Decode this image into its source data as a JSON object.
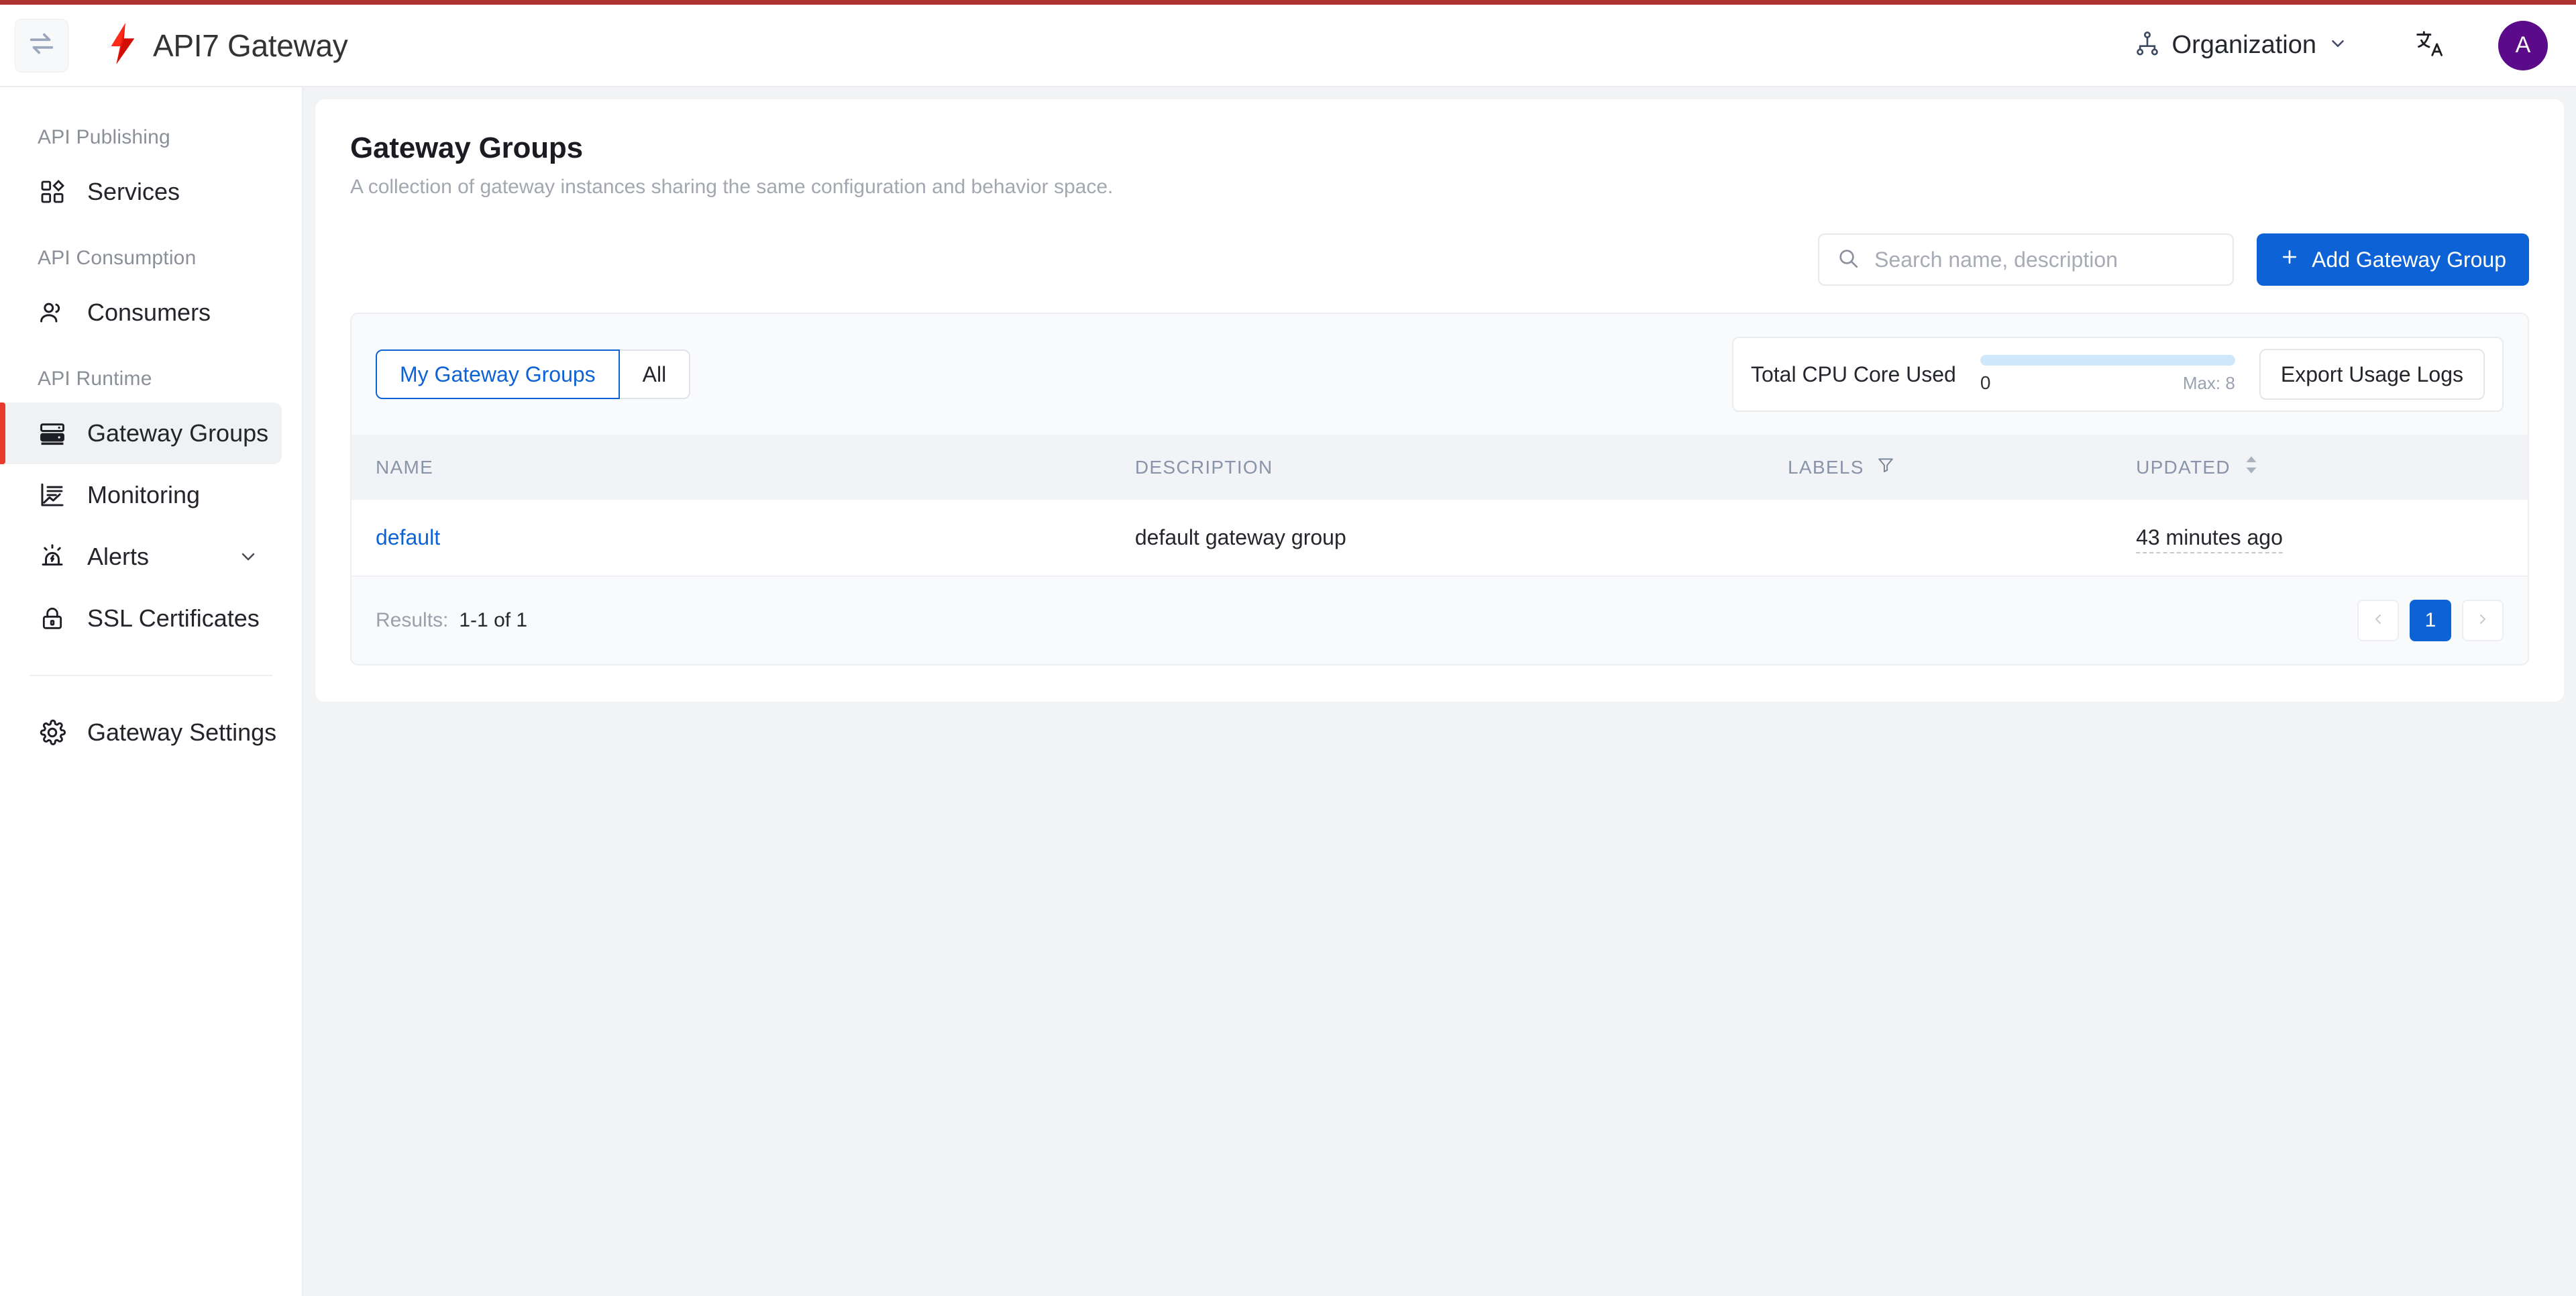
{
  "theme": {
    "accent_blue": "#0d63d6",
    "brand_red": "#e8392c",
    "stripe_red": "#ad3333",
    "avatar_purple": "#5b0b8a",
    "cpu_bar_blue": "#cfe7fb"
  },
  "header": {
    "collapse_icon": "collapse-sidebar-icon",
    "logo_icon": "api7-lightning-logo",
    "title": "API7 Gateway",
    "org_icon": "organization-hierarchy-icon",
    "org_label": "Organization",
    "org_chevron_icon": "chevron-down-icon",
    "language_icon": "translate-icon",
    "avatar_initial": "A"
  },
  "sidebar": {
    "groups": [
      {
        "title": "API Publishing",
        "items": [
          {
            "label": "Services",
            "icon": "grid-shapes-icon",
            "active": false,
            "expandable": false
          }
        ]
      },
      {
        "title": "API Consumption",
        "items": [
          {
            "label": "Consumers",
            "icon": "users-icon",
            "active": false,
            "expandable": false
          }
        ]
      },
      {
        "title": "API Runtime",
        "items": [
          {
            "label": "Gateway Groups",
            "icon": "server-rack-icon",
            "active": true,
            "expandable": false
          },
          {
            "label": "Monitoring",
            "icon": "chart-line-icon",
            "active": false,
            "expandable": false
          },
          {
            "label": "Alerts",
            "icon": "alarm-light-icon",
            "active": false,
            "expandable": true
          },
          {
            "label": "SSL Certificates",
            "icon": "lock-icon",
            "active": false,
            "expandable": false
          }
        ]
      }
    ],
    "footer_items": [
      {
        "label": "Gateway Settings",
        "icon": "gear-icon"
      }
    ]
  },
  "page": {
    "title": "Gateway Groups",
    "subtitle": "A collection of gateway instances sharing the same configuration and behavior space."
  },
  "toolbar": {
    "search_icon": "search-icon",
    "search_placeholder": "Search name, description",
    "search_value": "",
    "add_button_label": "Add Gateway Group",
    "add_button_icon": "plus-icon"
  },
  "tabs": [
    {
      "label": "My Gateway Groups",
      "active": true
    },
    {
      "label": "All",
      "active": false
    }
  ],
  "cpu": {
    "label": "Total CPU Core Used",
    "value": "0",
    "max_label": "Max: 8",
    "percent": 0,
    "export_button_label": "Export Usage Logs"
  },
  "table": {
    "columns": [
      {
        "key": "name",
        "label": "NAME",
        "icon": null
      },
      {
        "key": "description",
        "label": "DESCRIPTION",
        "icon": null
      },
      {
        "key": "labels",
        "label": "LABELS",
        "icon": "filter-funnel-icon"
      },
      {
        "key": "updated",
        "label": "UPDATED",
        "icon": "sort-arrows-icon"
      }
    ],
    "rows": [
      {
        "name": "default",
        "description": "default gateway group",
        "labels": "",
        "updated": "43 minutes ago"
      }
    ]
  },
  "footer": {
    "results_label": "Results:",
    "results_value": "1-1 of 1",
    "prev_icon": "chevron-left-icon",
    "next_icon": "chevron-right-icon",
    "current_page": "1"
  }
}
